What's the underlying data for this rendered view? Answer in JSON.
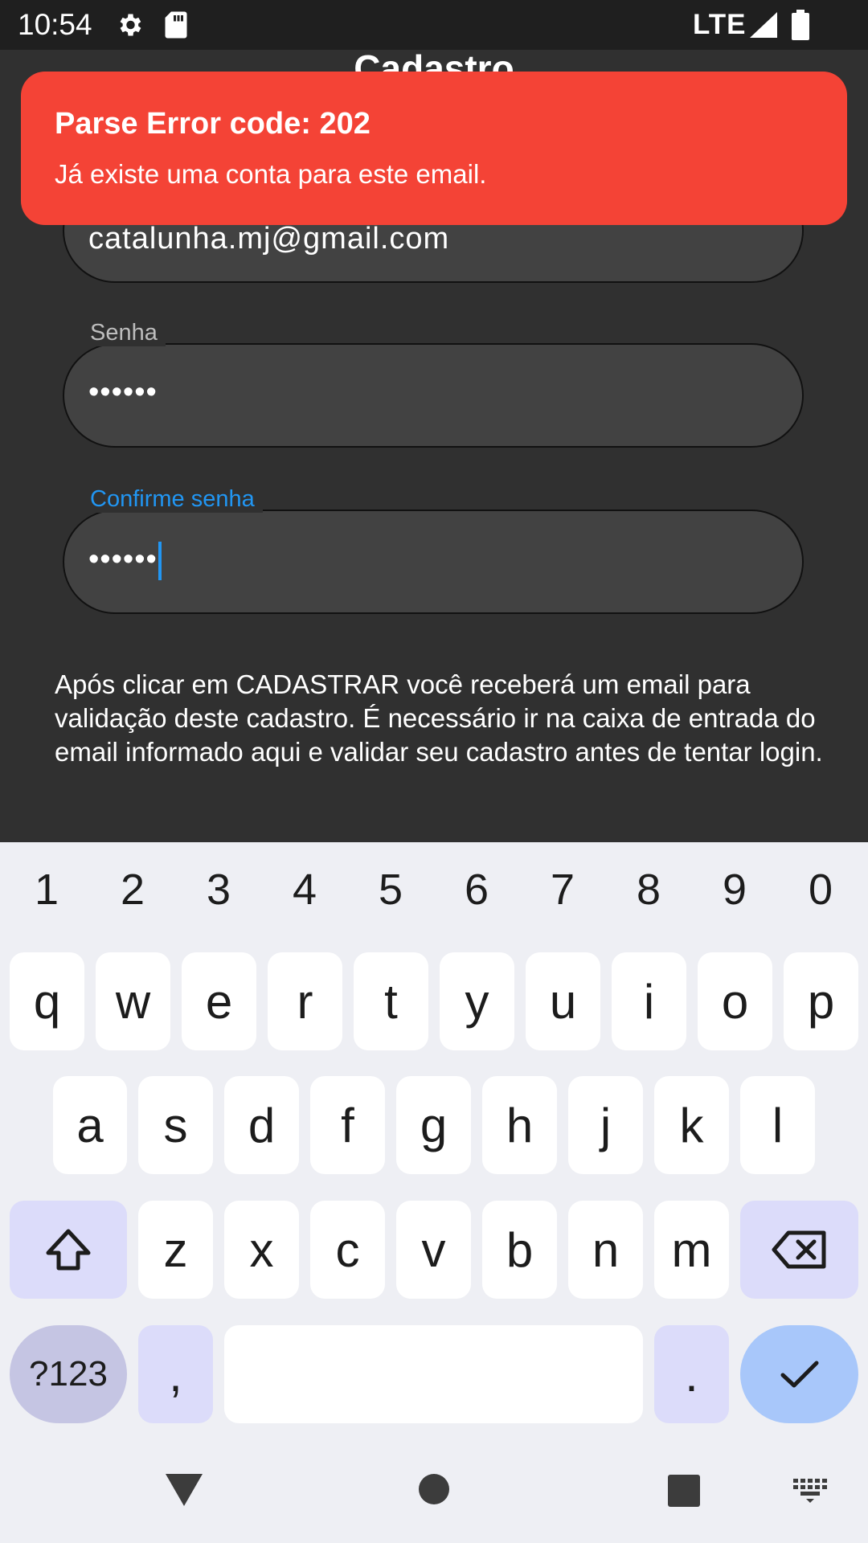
{
  "status_bar": {
    "time": "10:54",
    "network": "LTE"
  },
  "screen": {
    "title": "Cadastro",
    "email_field": {
      "value": "catalunha.mj@gmail.com"
    },
    "password_field": {
      "label": "Senha",
      "value": "••••••"
    },
    "confirm_field": {
      "label": "Confirme senha",
      "value": "••••••"
    },
    "info_text": "Após clicar em CADASTRAR você receberá um email para validação deste cadastro. É necessário ir na caixa de entrada do email informado aqui e validar seu cadastro antes de tentar login."
  },
  "toast": {
    "title": "Parse Error code: 202",
    "message": "Já existe uma conta para este email."
  },
  "keyboard": {
    "numbers": [
      "1",
      "2",
      "3",
      "4",
      "5",
      "6",
      "7",
      "8",
      "9",
      "0"
    ],
    "row1": [
      "q",
      "w",
      "e",
      "r",
      "t",
      "y",
      "u",
      "i",
      "o",
      "p"
    ],
    "row2": [
      "a",
      "s",
      "d",
      "f",
      "g",
      "h",
      "j",
      "k",
      "l"
    ],
    "row3": [
      "z",
      "x",
      "c",
      "v",
      "b",
      "n",
      "m"
    ],
    "symbols_key": "?123",
    "comma_key": ",",
    "period_key": "."
  },
  "colors": {
    "toast_bg": "#f44336",
    "focus_accent": "#2196f3",
    "app_bg": "#303030",
    "field_bg": "#424242",
    "done_key": "#a8c7fa"
  }
}
